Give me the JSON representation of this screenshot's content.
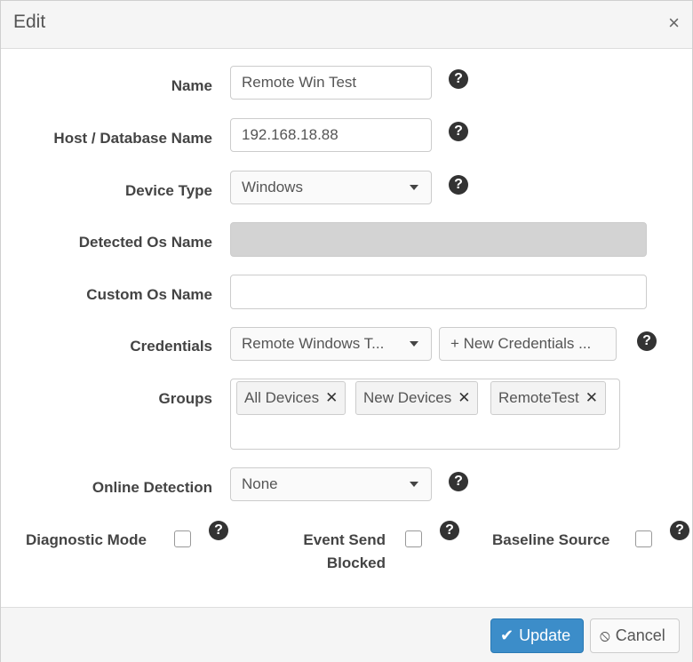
{
  "dialog": {
    "title": "Edit",
    "close_icon": "×"
  },
  "form": {
    "name": {
      "label": "Name",
      "value": "Remote Win Test"
    },
    "host": {
      "label": "Host / Database Name",
      "value": "192.168.18.88"
    },
    "device_type": {
      "label": "Device Type",
      "value": "Windows"
    },
    "detected_os": {
      "label": "Detected Os Name",
      "value": ""
    },
    "custom_os": {
      "label": "Custom Os Name",
      "value": ""
    },
    "credentials": {
      "label": "Credentials",
      "value": "Remote Windows T...",
      "new_label": "+ New Credentials ..."
    },
    "groups": {
      "label": "Groups",
      "tags": [
        "All Devices",
        "New Devices",
        "RemoteTest"
      ],
      "remove_icon": "✕"
    },
    "online_detection": {
      "label": "Online Detection",
      "value": "None"
    },
    "diagnostic_mode": {
      "label": "Diagnostic Mode",
      "checked": false
    },
    "event_send_blocked": {
      "label_line1": "Event Send",
      "label_line2": "Blocked",
      "checked": false
    },
    "baseline_source": {
      "label": "Baseline Source",
      "checked": false
    }
  },
  "help_icon": "?",
  "footer": {
    "update_label": "Update",
    "update_icon": "✔",
    "cancel_label": "Cancel",
    "cancel_icon": "⦸"
  },
  "colors": {
    "primary": "#3c8dc9",
    "header_bg": "#f5f5f5",
    "disabled_bg": "#d3d3d3"
  }
}
